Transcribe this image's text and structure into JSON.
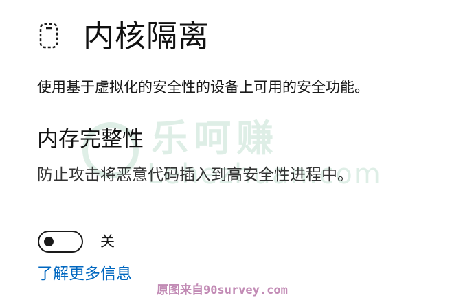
{
  "header": {
    "icon": "core-isolation-icon",
    "title": "内核隔离"
  },
  "page": {
    "description": "使用基于虚拟化的安全性的设备上可用的安全功能。"
  },
  "memory_integrity": {
    "title": "内存完整性",
    "description": "防止攻击将恶意代码插入到高安全性进程中。",
    "toggle": {
      "state_label": "关",
      "on": false
    }
  },
  "learn_more": {
    "label": "了解更多信息"
  },
  "watermark": {
    "cn": "乐呵赚",
    "en": "Lehezhuan.com"
  },
  "footer_watermark": {
    "text": "原图来自90survey.com"
  },
  "colors": {
    "link": "#0067c0",
    "text": "#111111"
  }
}
